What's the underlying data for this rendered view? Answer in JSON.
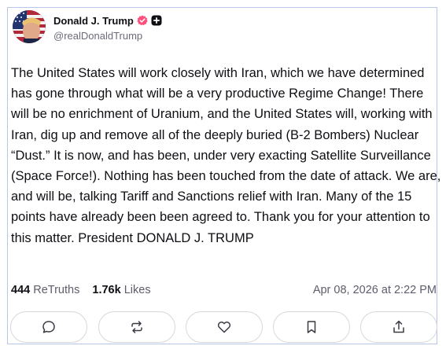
{
  "author": {
    "name": "Donald J. Trump",
    "handle": "@realDonaldTrump",
    "verified_color": "#ff4f7b"
  },
  "post": {
    "text": "The United States will work closely with Iran, which we have determined has gone through what will be a very productive Regime Change! There will be no enrichment of Uranium, and the United States will, working with Iran, dig up and remove all of the deeply buried (B-2 Bombers) Nuclear “Dust.” It is now, and has been, under very exacting Satellite Surveillance (Space Force!). Nothing has been touched from the date of attack. We are, and will be, talking Tariff and Sanctions relief with Iran. Many of the 15 points have already been been agreed to. Thank you for your attention to this matter. President DONALD J. TRUMP"
  },
  "stats": {
    "retruths_count": "444",
    "retruths_label": "ReTruths",
    "likes_count": "1.76k",
    "likes_label": "Likes",
    "timestamp": "Apr 08, 2026 at 2:22 PM"
  },
  "actions": [
    {
      "icon": "comment-icon"
    },
    {
      "icon": "retruth-icon"
    },
    {
      "icon": "heart-icon"
    },
    {
      "icon": "bookmark-icon"
    },
    {
      "icon": "share-icon"
    }
  ],
  "colors": {
    "card_border": "#b9c6ec",
    "text": "#0f0f14",
    "muted": "#5d5d6b",
    "button_border": "#d7d8dd"
  }
}
